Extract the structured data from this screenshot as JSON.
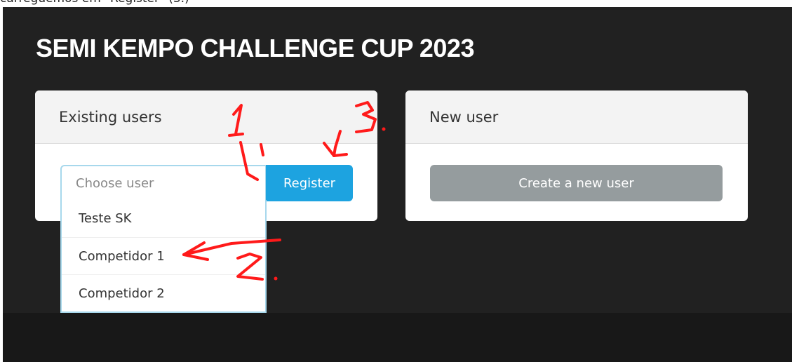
{
  "caption": "carreguemos em \"Register\" (3.)",
  "app": {
    "title": "SEMI KEMPO CHALLENGE CUP 2023"
  },
  "existing_users": {
    "header": "Existing users",
    "select_placeholder": "Choose user",
    "register_label": "Register",
    "options": [
      "Teste SK",
      "Competidor 1",
      "Competidor 2"
    ]
  },
  "new_user": {
    "header": "New user",
    "create_label": "Create a new user"
  },
  "annotations": {
    "color": "#ff1a1a",
    "marks": [
      "1.",
      "2.",
      "3."
    ]
  }
}
